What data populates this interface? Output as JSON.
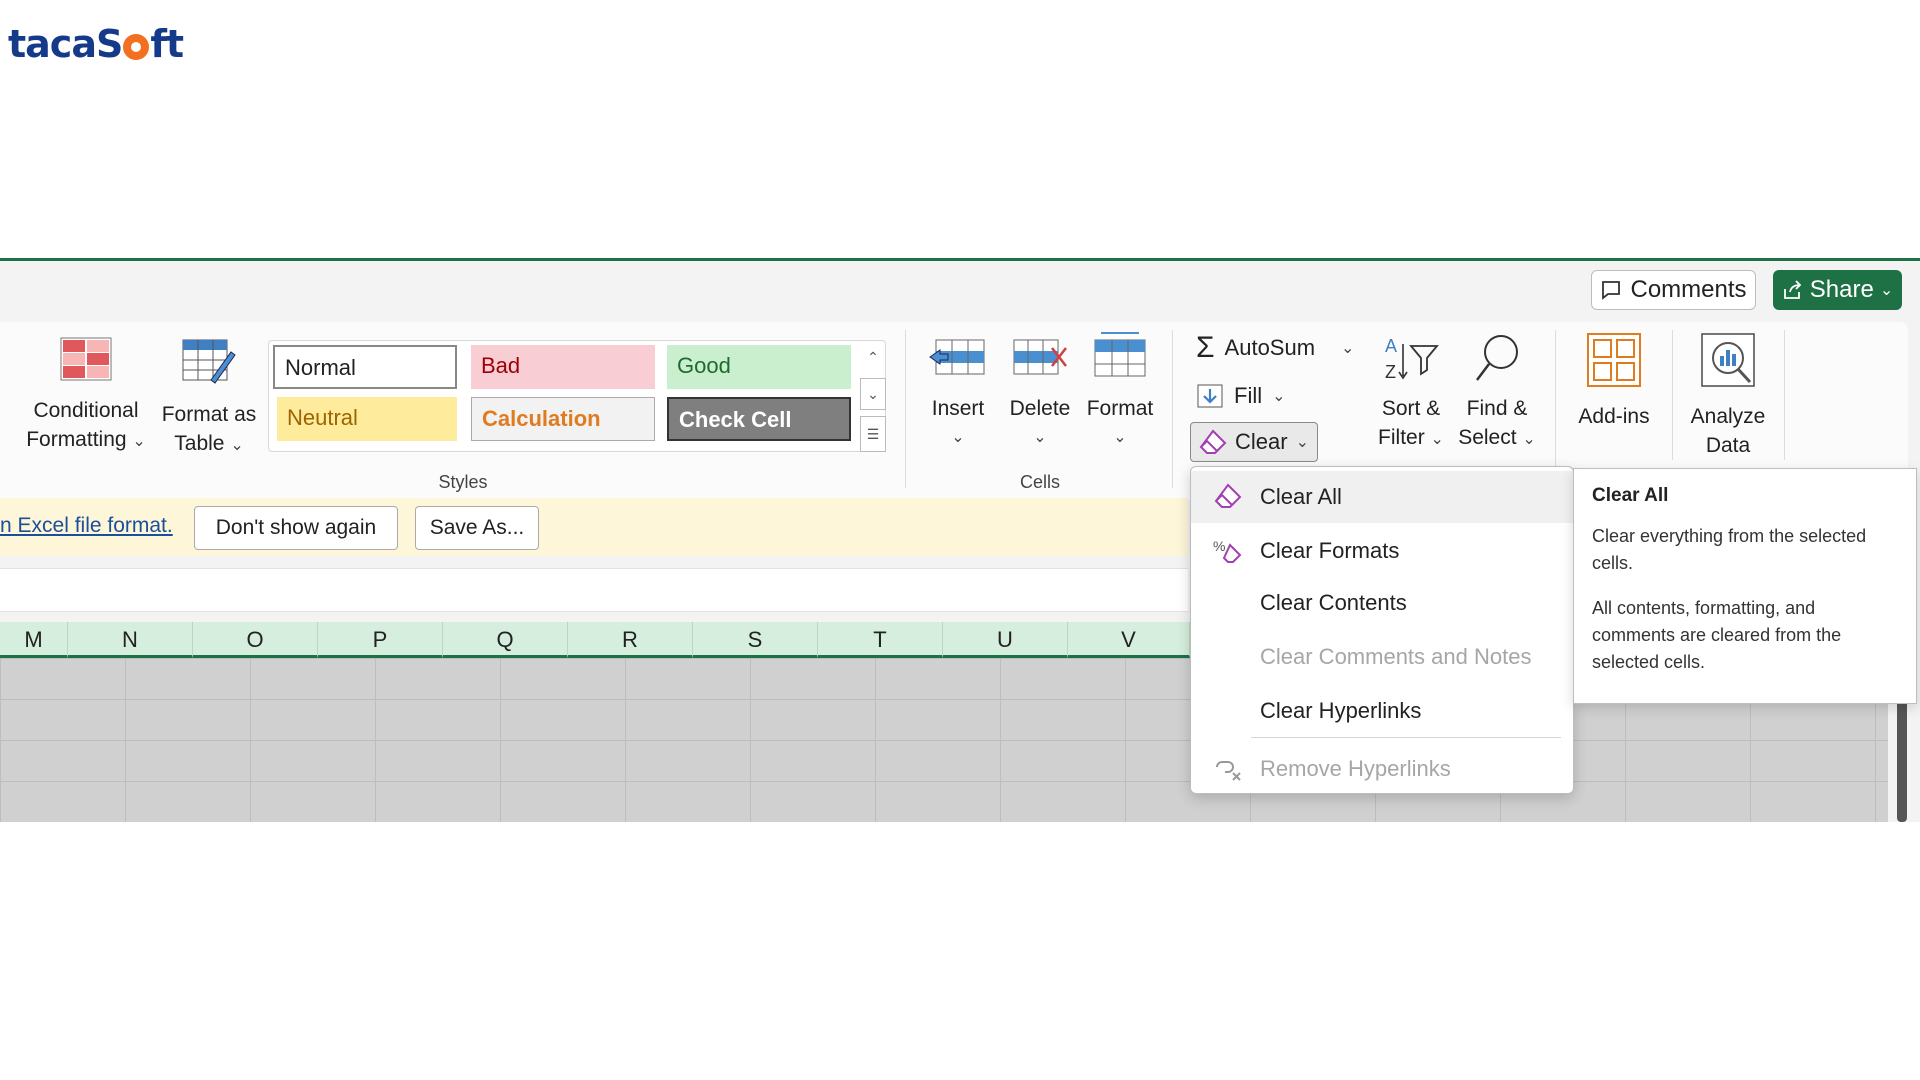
{
  "logo": {
    "part1": "taca",
    "part2": "S",
    "part3": "ft"
  },
  "header": {
    "comments_label": "Comments",
    "share_label": "Share"
  },
  "ribbon": {
    "conditional_formatting": {
      "line1": "Conditional",
      "line2": "Formatting"
    },
    "format_as_table": {
      "line1": "Format as",
      "line2": "Table"
    },
    "styles": {
      "group_label": "Styles",
      "cells": [
        {
          "label": "Normal",
          "bg": "#ffffff",
          "color": "#222222"
        },
        {
          "label": "Bad",
          "bg": "#f8cdd3",
          "color": "#9c0006"
        },
        {
          "label": "Good",
          "bg": "#c9efce",
          "color": "#1e6b2c"
        },
        {
          "label": "Neutral",
          "bg": "#ffeb9c",
          "color": "#9c6500"
        },
        {
          "label": "Calculation",
          "bg": "#f2f2f2",
          "color": "#e07b20"
        },
        {
          "label": "Check Cell",
          "bg": "#7f7f7f",
          "color": "#ffffff"
        }
      ]
    },
    "cells_group": {
      "group_label": "Cells",
      "insert": "Insert",
      "delete": "Delete",
      "format": "Format"
    },
    "editing": {
      "autosum": "AutoSum",
      "fill": "Fill",
      "clear": "Clear",
      "sort_filter": {
        "line1": "Sort &",
        "line2": "Filter"
      },
      "find_select": {
        "line1": "Find &",
        "line2": "Select"
      }
    },
    "addins": "Add-ins",
    "analyze": {
      "line1": "Analyze",
      "line2": "Data"
    }
  },
  "message_bar": {
    "link_text": "n Excel file format.",
    "dont_show": "Don't show again",
    "save_as": "Save As..."
  },
  "columns": [
    "M",
    "N",
    "O",
    "P",
    "Q",
    "R",
    "S",
    "T",
    "U",
    "V"
  ],
  "clear_menu": {
    "items": [
      {
        "label": "Clear All",
        "state": "highlighted"
      },
      {
        "label": "Clear Formats",
        "state": "normal"
      },
      {
        "label": "Clear Contents",
        "state": "normal"
      },
      {
        "label": "Clear Comments and Notes",
        "state": "disabled"
      },
      {
        "label": "Clear Hyperlinks",
        "state": "normal"
      },
      {
        "label": "Remove Hyperlinks",
        "state": "disabled"
      }
    ]
  },
  "tooltip": {
    "title": "Clear All",
    "desc1": "Clear everything from the selected cells.",
    "desc2": "All contents, formatting, and comments are cleared from the selected cells."
  },
  "colors": {
    "accent": "#1e7145",
    "header_bg": "#d6eedd",
    "message_bg": "#fdf6d8"
  }
}
